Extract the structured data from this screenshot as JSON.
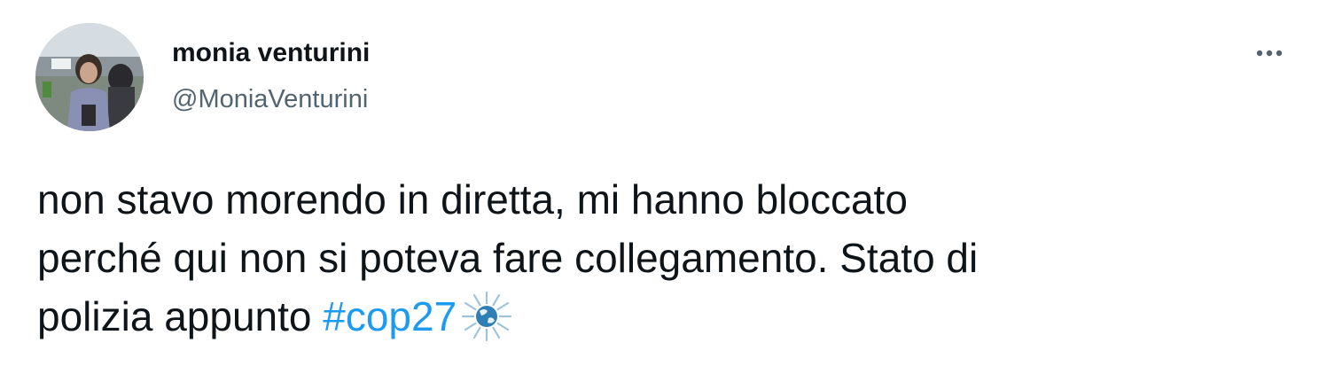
{
  "tweet": {
    "author": {
      "display_name": "monia venturini",
      "handle": "@MoniaVenturini",
      "avatar_icon": "user-avatar-photo"
    },
    "more_icon": "more-horizontal-icon",
    "text_lines": [
      "non stavo morendo in diretta, mi hanno bloccato",
      "perché qui non si poteva fare collegamento. Stato di",
      "polizia appunto "
    ],
    "hashtag": "#cop27",
    "hashflag_icon": "cop27-sun-globe-icon"
  },
  "colors": {
    "text": "#0f1419",
    "secondary_text": "#536471",
    "link": "#1d9bf0",
    "background": "#ffffff"
  }
}
